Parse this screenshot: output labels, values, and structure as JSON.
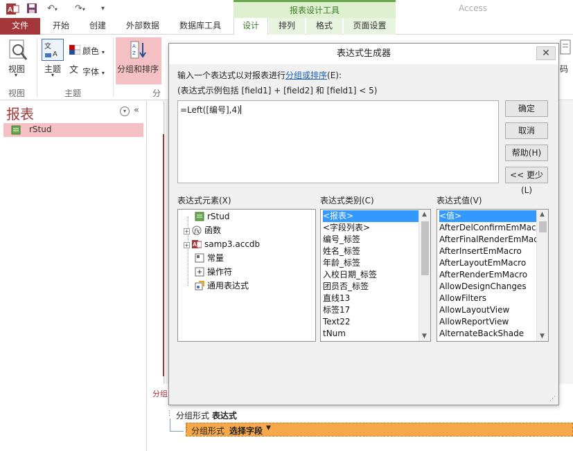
{
  "app": {
    "name": "Access",
    "context_tab_group": "报表设计工具"
  },
  "tabs": [
    {
      "label": "文件"
    },
    {
      "label": "开始"
    },
    {
      "label": "创建"
    },
    {
      "label": "外部数据"
    },
    {
      "label": "数据库工具"
    },
    {
      "label": "设计"
    },
    {
      "label": "排列"
    },
    {
      "label": "格式"
    },
    {
      "label": "页面设置"
    }
  ],
  "ribbon": {
    "view_label": "视图",
    "theme_label": "主题",
    "colors_label": "颜色",
    "fonts_label": "字体",
    "group_sort_label": "分组和排序",
    "group_view": "视图",
    "group_theme": "主题",
    "group_grouping_partial": "分",
    "right_partial": "码",
    "colors": {
      "file_tab": "#a4373a",
      "context_green": "#3a7d24",
      "highlight": "#f5c0c3"
    }
  },
  "nav": {
    "title": "报表",
    "item": "rStud"
  },
  "grouping": {
    "label_partial": "分组",
    "group_form_label": "分组形式",
    "group_form_value": "表达式",
    "select_field_prefix": "分组形式",
    "select_field_label": "选择字段"
  },
  "dialog": {
    "title": "表达式生成器",
    "close_label": "✕",
    "instruction_prefix": "输入一个表达式以对报表进行",
    "instruction_link": "分组或排序",
    "instruction_suffix": "(E):",
    "example": "(表达式示例包括 [field1] + [field2] 和 [field1] < 5)",
    "expression": "=Left([编号],4)",
    "buttons": {
      "ok": "确定",
      "cancel": "取消",
      "help": "帮助(H)",
      "less": "<< 更少(L)"
    },
    "elements_label": "表达式元素(X)",
    "categories_label": "表达式类别(C)",
    "values_label": "表达式值(V)",
    "elements": [
      {
        "label": "rStud",
        "icon": "report-icon"
      },
      {
        "label": "函数",
        "icon": "function-icon"
      },
      {
        "label": "samp3.accdb",
        "icon": "database-icon"
      },
      {
        "label": "常量",
        "icon": "constant-icon"
      },
      {
        "label": "操作符",
        "icon": "operator-icon"
      },
      {
        "label": "通用表达式",
        "icon": "common-expression-icon"
      }
    ],
    "categories": [
      "<报表>",
      "<字段列表>",
      "编号_标签",
      "姓名_标签",
      "年龄_标签",
      "入校日期_标签",
      "团员否_标签",
      "直线13",
      "标签17",
      "Text22",
      "tNum"
    ],
    "values": [
      "<值>",
      "AfterDelConfirmEmMacr",
      "AfterFinalRenderEmMac",
      "AfterInsertEmMacro",
      "AfterLayoutEmMacro",
      "AfterRenderEmMacro",
      "AllowDesignChanges",
      "AllowFilters",
      "AllowLayoutView",
      "AllowReportView",
      "AlternateBackShade"
    ]
  }
}
